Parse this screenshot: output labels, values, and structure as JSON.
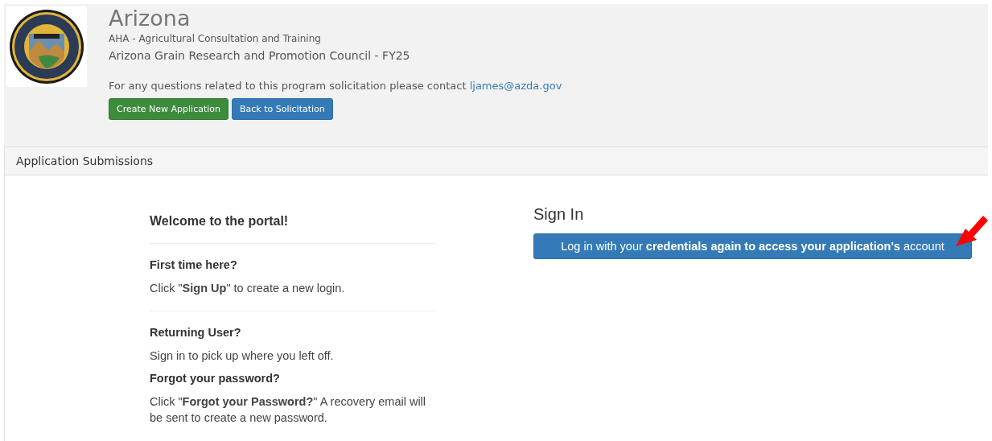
{
  "header": {
    "title": "Arizona",
    "subtitle": "AHA - Agricultural Consultation and Training",
    "program": "Arizona Grain Research and Promotion Council - FY25",
    "contact_text": "For any questions related to this program solicitation please contact",
    "contact_email": "ljames@azda.gov",
    "buttons": [
      {
        "label": "Create New Application",
        "kind": "success"
      },
      {
        "label": "Back to Solicitation",
        "kind": "primary"
      }
    ]
  },
  "panel": {
    "title": "Application Submissions"
  },
  "welcome": {
    "title": "Welcome to the portal!",
    "sections": [
      {
        "heading": "First time here?",
        "text": "Click \"**Sign Up**\" to create a new login.",
        "divider_before": true,
        "divider_after": true
      },
      {
        "heading": "Returning User?",
        "text": "Sign in to pick up where you left off.",
        "divider_before": false,
        "divider_after": false
      },
      {
        "heading": "Forgot your password?",
        "text": "Click \"**Forgot your Password?**\" A recovery email will be sent to create a new password.",
        "divider_before": false,
        "divider_after": false
      }
    ]
  },
  "sign_in": {
    "title": "Sign In",
    "button": "Log in with your **credentials again to access your application's** account"
  }
}
